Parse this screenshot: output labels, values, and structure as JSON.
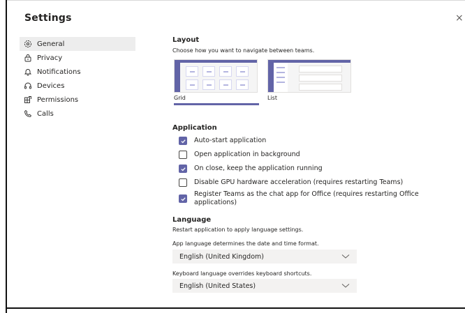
{
  "dialog": {
    "title": "Settings",
    "close_glyph": "×"
  },
  "nav": {
    "items": [
      {
        "label": "General",
        "icon": "gear-icon",
        "active": true
      },
      {
        "label": "Privacy",
        "icon": "lock-icon",
        "active": false
      },
      {
        "label": "Notifications",
        "icon": "bell-icon",
        "active": false
      },
      {
        "label": "Devices",
        "icon": "headset-icon",
        "active": false
      },
      {
        "label": "Permissions",
        "icon": "permissions-icon",
        "active": false
      },
      {
        "label": "Calls",
        "icon": "phone-icon",
        "active": false
      }
    ]
  },
  "layout": {
    "title": "Layout",
    "description": "Choose how you want to navigate between teams.",
    "options": [
      {
        "label": "Grid",
        "selected": true
      },
      {
        "label": "List",
        "selected": false
      }
    ]
  },
  "application": {
    "title": "Application",
    "options": [
      {
        "label": "Auto-start application",
        "checked": true
      },
      {
        "label": "Open application in background",
        "checked": false
      },
      {
        "label": "On close, keep the application running",
        "checked": true
      },
      {
        "label": "Disable GPU hardware acceleration (requires restarting Teams)",
        "checked": false
      },
      {
        "label": "Register Teams as the chat app for Office (requires restarting Office applications)",
        "checked": true
      }
    ]
  },
  "language": {
    "title": "Language",
    "restart_note": "Restart application to apply language settings.",
    "app_language_note": "App language determines the date and time format.",
    "app_language_value": "English (United Kingdom)",
    "keyboard_note": "Keyboard language overrides keyboard shortcuts.",
    "keyboard_value": "English (United States)"
  },
  "colors": {
    "accent": "#6264a7",
    "selected_nav_bg": "#ededed",
    "dropdown_bg": "#f3f2f1"
  }
}
